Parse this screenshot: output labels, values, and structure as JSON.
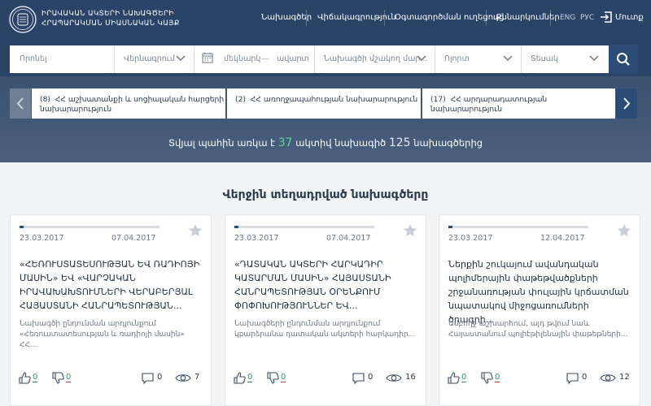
{
  "header": {
    "brand_line1": "ԻՐԱՎԱԿԱՆ ԱԿՏԵՐԻ ՆԱԽԱԳԾԵՐԻ",
    "brand_line2": "ՀՐԱՊԱՐԱԿՄԱՆ ՄԻԱՍՆԱԿԱՆ ԿԱՅՔ",
    "nav": [
      "Նախագծեր",
      "Վիճակագրություն",
      "Օգտագործման ուղեցույց",
      "Քննարկումներ"
    ],
    "lang_en": "ENG",
    "lang_ru": "РУС",
    "login": "Մուտք"
  },
  "search": {
    "search_placeholder": "Որոնել",
    "status_placeholder": "Վերնագրում",
    "date_from": "մեկնարկ",
    "date_to": "ավարտ",
    "project_type": "Նախագծի մշակող մար...",
    "field": "Ոլորտ",
    "type": "Տեսակ"
  },
  "ministries": [
    {
      "count": "(8)",
      "name": "ՀՀ աշխատանքի և սոցիալական հարցերի նախարարություն"
    },
    {
      "count": "(2)",
      "name": "ՀՀ առողջապահության նախարարություն"
    },
    {
      "count": "(17)",
      "name": "ՀՀ արդարադատության նախարարություն"
    }
  ],
  "stats": {
    "prefix": "Տվյալ պահին առկա է",
    "active": "37",
    "middle": "ակտիվ նախագիծ",
    "total": "125",
    "suffix": "նախագծերից"
  },
  "section_title": "Վերջին տեղադրված նախագծերը",
  "cards": [
    {
      "progress": 0.03,
      "date_start": "23.03.2017",
      "date_end": "07.04.2017",
      "title": "«ՀԵՌՈՒՍՏԱՏԵՍՈՒԹՅԱՆ ԵՎ ՌԱԴԻՈՅԻ ՄԱՍԻՆ» ԵՎ «ՎԱՐՉԱԿԱՆ ԻՐԱՎԱԽԱԽՏՈՒՄՆԵՐԻ ՎԵՐԱԲԵՐՅԱԼ ՀԱՅԱՍՏԱՆԻ ՀԱՆՐԱՊԵՏՈՒԹՅԱՆ...",
      "desc": "Նախագծի ընդունման արդյունքում «Հեռուստատեսության և ռադիոյի մասին» ՀՀ...",
      "likes": "0",
      "dislikes": "0",
      "comments": "0",
      "views": "7"
    },
    {
      "progress": 0.03,
      "date_start": "23.03.2017",
      "date_end": "07.04.2017",
      "title": "«ԴԱՏԱԿԱՆ ԱԿՏԵՐԻ ՀԱՐԿԱԴԻՐ ԿԱՏԱՐՄԱՆ ՄԱՍԻՆ» ՀԱՅԱՍՏԱՆԻ ՀԱՆՐԱՊԵՏՈՒԹՅԱՆ ՕՐԵՆՔՈՒՄ ՓՈՓՈԽՈՒԹՅՈՒՆՆԵՐ ԵՎ...",
      "desc": "Նախագծերի ընդունման արդյունքում կբարձրանա դատական ակտերի հարկադիր...",
      "likes": "0",
      "dislikes": "0",
      "comments": "0",
      "views": "16"
    },
    {
      "progress": 0.03,
      "date_start": "23.03.2017",
      "date_end": "12.04.2017",
      "title": "Ներքին շուկայում ավանդական պոլիմերային փաթեթվածքների շրջանառության փուլային կրճատման նպատակով միջոցառումների ծրագրի...",
      "desc": "Ամբողջ աշխարհում, այդ թվում նաև Հայաստանում պոլիէթիլենային փաթեթների...",
      "likes": "0",
      "dislikes": "0",
      "comments": "0",
      "views": "12"
    }
  ],
  "colors": {
    "header": "#2a4468",
    "band": "#3a5170",
    "accent_green": "#5bd49b",
    "button": "#2b4c74"
  }
}
